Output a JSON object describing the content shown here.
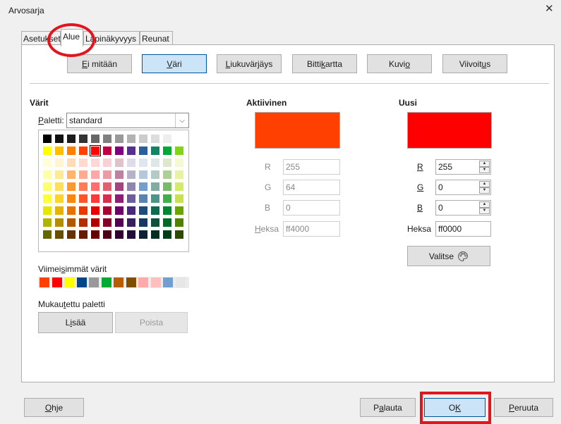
{
  "window": {
    "title": "Arvosarja",
    "close_glyph": "✕"
  },
  "tabs": [
    {
      "label": "Asetukset",
      "active": false
    },
    {
      "label": "Alue",
      "active": true
    },
    {
      "label": "Läpinäkyvyys",
      "active": false
    },
    {
      "label": "Reunat",
      "active": false
    }
  ],
  "fill_types": [
    {
      "label": "Ei mitään",
      "accel": "E",
      "selected": false
    },
    {
      "label": "Väri",
      "accel": "V",
      "selected": true
    },
    {
      "label": "Liukuvärjäys",
      "accel": "L",
      "selected": false
    },
    {
      "label": "Bittikartta",
      "accel": "k",
      "selected": false
    },
    {
      "label": "Kuvio",
      "accel": "o",
      "selected": false
    },
    {
      "label": "Viivoitus",
      "accel": "u",
      "selected": false
    }
  ],
  "colors": {
    "heading": "Värit",
    "palette_label": "Paletti:",
    "palette_value": "standard",
    "recent_label": "Viimeisimmät värit",
    "custom_label": "Mukautettu paletti",
    "add_label": "Lisää",
    "delete_label": "Poista",
    "recent_colors": [
      "#ff4000",
      "#ff0000",
      "#ffff00",
      "#004586",
      "#999999",
      "#00a933",
      "#b85c00",
      "#7f4f00",
      "#ffaaaa",
      "#ffbfbf",
      "#729fcf",
      "#e6e6e6"
    ]
  },
  "active": {
    "heading": "Aktiivinen",
    "color": "#ff4000",
    "r_label": "R",
    "r": "255",
    "g_label": "G",
    "g": "64",
    "b_label": "B",
    "b": "0",
    "hex_label": "Heksa",
    "hex": "ff4000"
  },
  "new": {
    "heading": "Uusi",
    "color": "#ff0000",
    "r_label": "R",
    "r": "255",
    "g_label": "G",
    "g": "0",
    "b_label": "B",
    "b": "0",
    "hex_label": "Heksa",
    "hex": "ff0000",
    "pick_label": "Valitse",
    "pick_icon": "palette-icon"
  },
  "footer": {
    "help": "Ohje",
    "reset": "Palauta",
    "ok": "OK",
    "cancel": "Peruuta"
  },
  "palette": [
    [
      "#000000",
      "#111111",
      "#1c1c1c",
      "#333333",
      "#666666",
      "#808080",
      "#999999",
      "#b2b2b2",
      "#cccccc",
      "#dddddd",
      "#eeeeee",
      "#ffffff"
    ],
    [
      "#ffff00",
      "#ffbf00",
      "#ff8000",
      "#ff4000",
      "#ff0000",
      "#bf0041",
      "#800080",
      "#55308d",
      "#2a6099",
      "#158466",
      "#00a933",
      "#81d41a"
    ],
    [
      "#ffffd7",
      "#fff5ce",
      "#ffdbb6",
      "#ffd8ce",
      "#ffd7d7",
      "#f7d1d5",
      "#e0c2cd",
      "#dedce6",
      "#dee6ef",
      "#dee7e5",
      "#dde8cb",
      "#f6f9d4"
    ],
    [
      "#ffffa6",
      "#ffe994",
      "#ffb66c",
      "#ffaa95",
      "#ffa6a6",
      "#ec9ba4",
      "#bf819e",
      "#b7b3ca",
      "#b4c7dc",
      "#b3cac7",
      "#afd095",
      "#e8f2a1"
    ],
    [
      "#ffff6d",
      "#ffde59",
      "#ff972f",
      "#ff7b59",
      "#ff6d6d",
      "#e16173",
      "#a1467e",
      "#8e86ae",
      "#729fcf",
      "#81aca6",
      "#77bc65",
      "#d4ea6b"
    ],
    [
      "#ffff38",
      "#ffd428",
      "#ff860d",
      "#ff5429",
      "#ff3838",
      "#d62e4e",
      "#8d1d75",
      "#6b5e9b",
      "#5983b0",
      "#50938a",
      "#3faf46",
      "#c9e14e"
    ],
    [
      "#e6e600",
      "#e6b400",
      "#e67300",
      "#e63900",
      "#e60000",
      "#a90034",
      "#6c006c",
      "#492a7a",
      "#1c4d7d",
      "#0e6b4f",
      "#00872e",
      "#6aa400"
    ],
    [
      "#b2b200",
      "#b28e00",
      "#b25900",
      "#b22d00",
      "#b20000",
      "#830028",
      "#530053",
      "#382060",
      "#163b62",
      "#0b533d",
      "#006922",
      "#528000"
    ],
    [
      "#666600",
      "#664f00",
      "#663300",
      "#661a00",
      "#660000",
      "#4a0016",
      "#300030",
      "#210f39",
      "#0c2138",
      "#062f22",
      "#003c14",
      "#2e4a00"
    ]
  ]
}
